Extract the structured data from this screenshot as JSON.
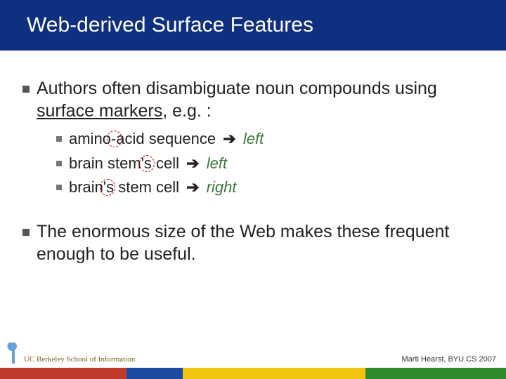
{
  "title": "Web-derived Surface Features",
  "point1_a": "Authors often disambiguate noun compounds using ",
  "point1_b": "surface markers",
  "point1_c": ", e.g. :",
  "sub1_phrase": "amino-acid sequence",
  "sub1_dir": "left",
  "sub2_phrase": "brain stem's cell",
  "sub2_dir": "left",
  "sub3_phrase": "brain's stem cell",
  "sub3_dir": "right",
  "arrow_glyph": "➔",
  "point2": "The enormous size of the Web makes these frequent enough to be useful.",
  "attribution": "Marti Hearst, BYU CS 2007",
  "logo_text": "UC Berkeley School of Information"
}
